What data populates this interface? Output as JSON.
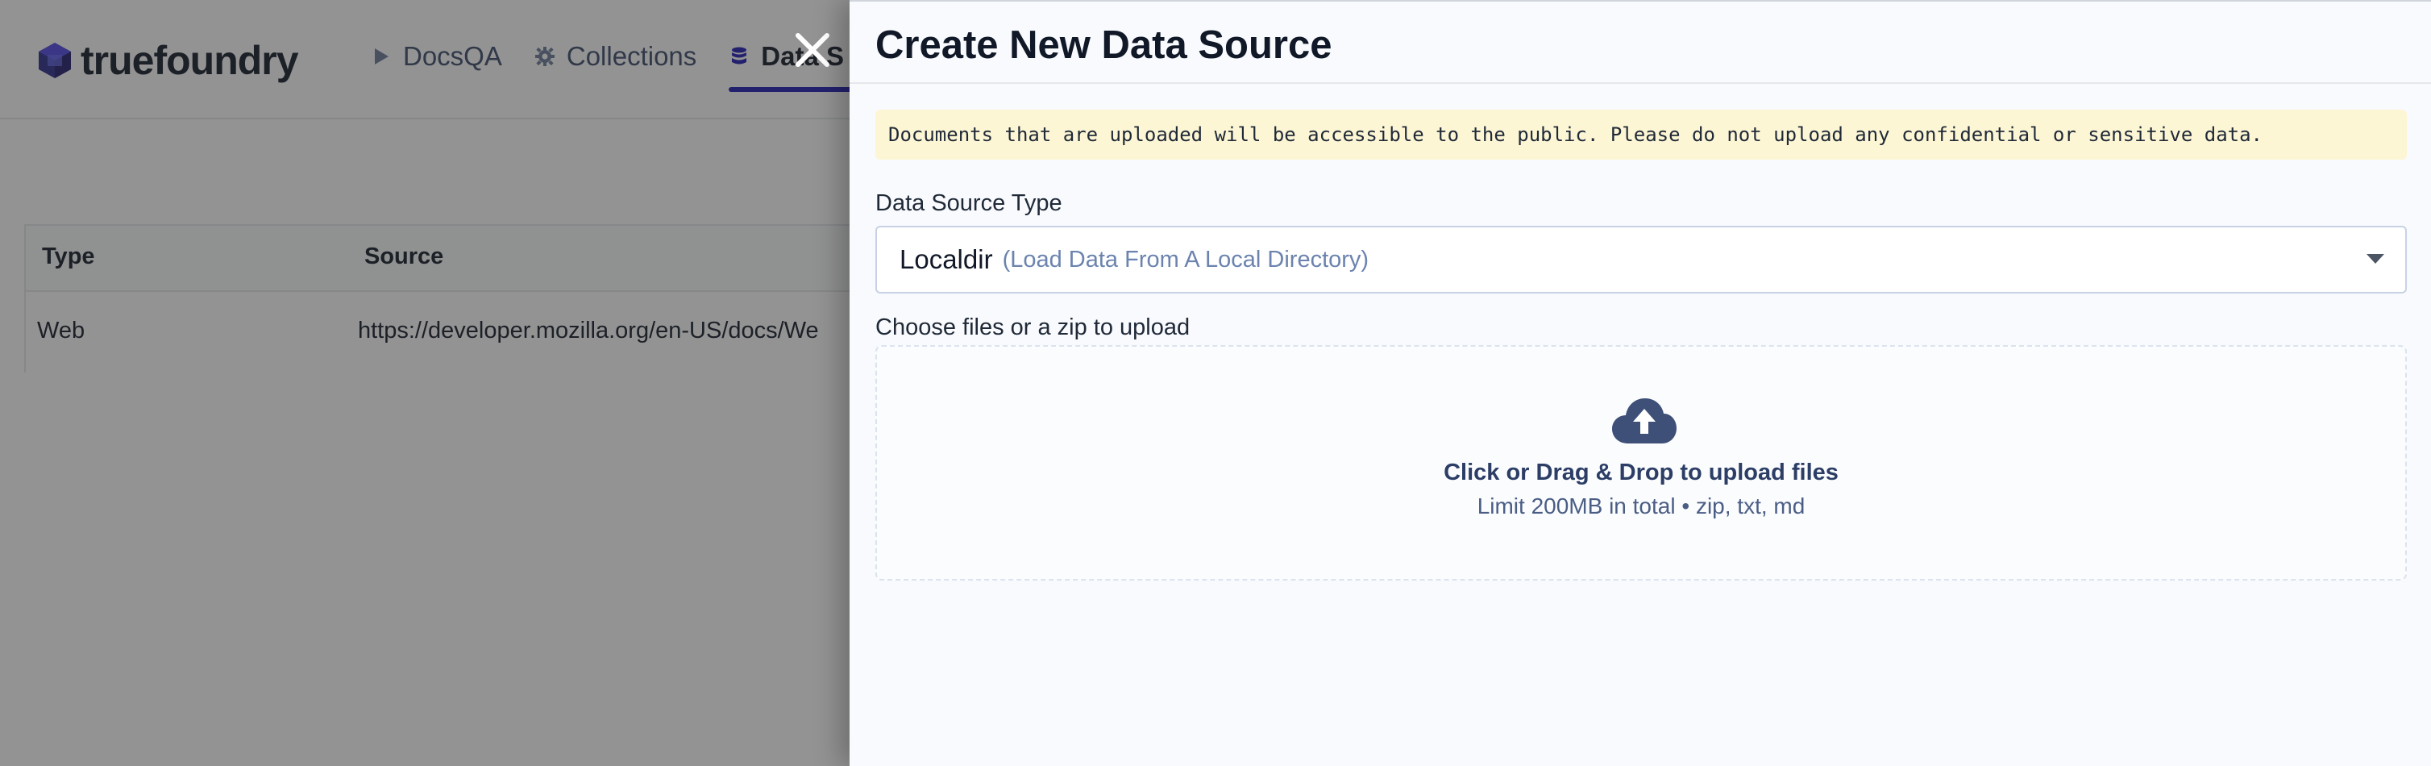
{
  "app": {
    "brand": "truefoundry",
    "nav": [
      {
        "label": "DocsQA",
        "icon": "play-icon"
      },
      {
        "label": "Collections",
        "icon": "gear-icon"
      },
      {
        "label": "Data S",
        "icon": "database-icon"
      }
    ],
    "table": {
      "columns": [
        "Type",
        "Source"
      ],
      "rows": [
        {
          "type": "Web",
          "source": "https://developer.mozilla.org/en-US/docs/We"
        }
      ]
    }
  },
  "drawer": {
    "title": "Create New Data Source",
    "warning": "Documents that are uploaded will be accessible to the public. Please do not upload any confidential or sensitive data.",
    "source_type_label": "Data Source Type",
    "source_type_value": "Localdir",
    "source_type_hint": "(Load Data From A Local Directory)",
    "upload_label": "Choose files or a zip to upload",
    "upload_title": "Click or Drag & Drop to upload files",
    "upload_limits": "Limit 200MB in total • zip, txt, md"
  },
  "colors": {
    "accent": "#1f1bb4",
    "warning_bg": "#fdf6d5",
    "upload_icon": "#3e4f78"
  }
}
